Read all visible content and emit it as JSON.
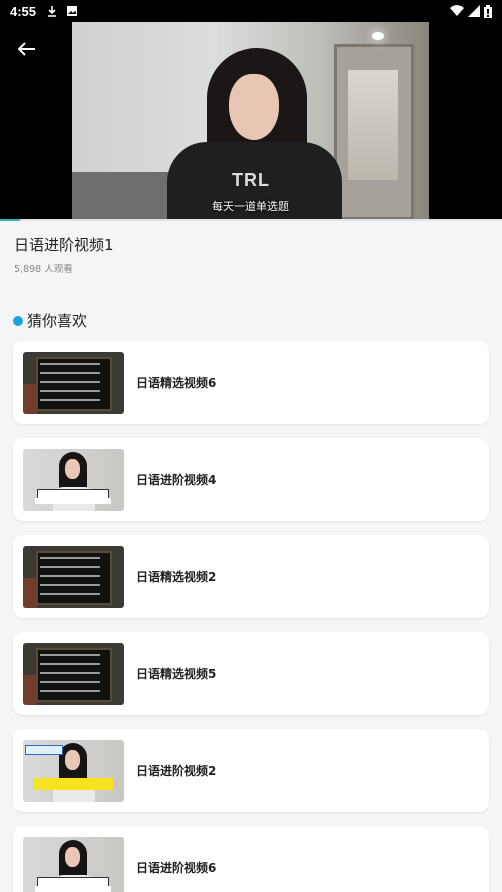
{
  "status_bar": {
    "time": "4:55"
  },
  "video": {
    "subtitle": "每天一道单选题",
    "title": "日语进阶视频1",
    "views": "5,898 人观看",
    "progress": 0.04
  },
  "section": {
    "title": "猜你喜欢"
  },
  "recommendations": [
    {
      "title": "日语精选视频6",
      "thumb_style": "chalk"
    },
    {
      "title": "日语进阶视频4",
      "thumb_style": "girl"
    },
    {
      "title": "日语精选视频2",
      "thumb_style": "chalk"
    },
    {
      "title": "日语精选视频5",
      "thumb_style": "chalk"
    },
    {
      "title": "日语进阶视频2",
      "thumb_style": "girl"
    },
    {
      "title": "日语进阶视频6",
      "thumb_style": "girl"
    }
  ],
  "colors": {
    "accent": "#1ba4dd",
    "progress": "#2bb3b5"
  },
  "icons": [
    "download-icon",
    "image-icon",
    "wifi-icon",
    "signal-icon",
    "battery-icon",
    "back-arrow-icon"
  ]
}
